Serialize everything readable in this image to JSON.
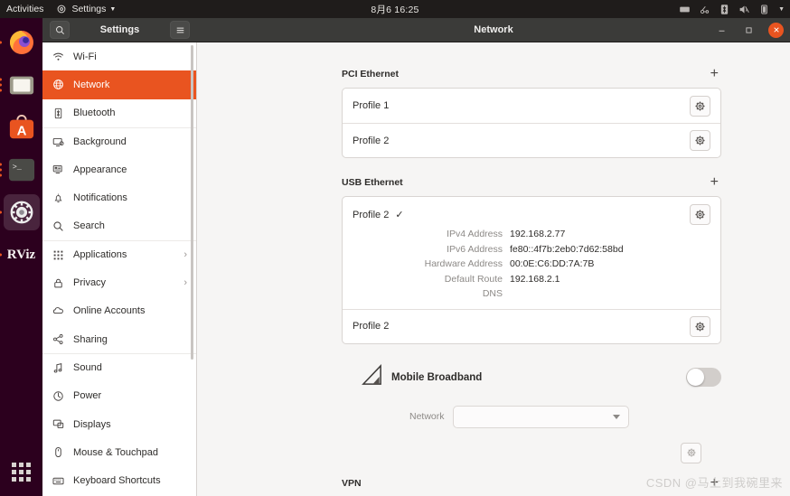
{
  "topbar": {
    "activities": "Activities",
    "app_menu": "Settings",
    "clock": "8月6  16:25",
    "indicators": [
      "keyboard-icon",
      "network-icon",
      "bluetooth-icon",
      "volume-icon",
      "battery-icon",
      "chevron-down-icon"
    ]
  },
  "dock": {
    "items": [
      {
        "name": "firefox",
        "label": "Firefox"
      },
      {
        "name": "files",
        "label": "Files"
      },
      {
        "name": "ubuntu-software",
        "label": "Ubuntu Software"
      },
      {
        "name": "terminal",
        "label": "Terminal"
      },
      {
        "name": "settings",
        "label": "Settings"
      },
      {
        "name": "rviz",
        "label": "RViz"
      }
    ],
    "show_apps": "Show Applications"
  },
  "window": {
    "sidebar_title": "Settings",
    "main_title": "Network",
    "search_icon": "search-icon",
    "menu_icon": "hamburger-icon",
    "minimize": "–",
    "maximize": "❐",
    "close": "✕"
  },
  "sidebar": {
    "items": [
      {
        "label": "Wi-Fi",
        "icon": "wifi-icon",
        "selected": false,
        "chevron": false,
        "sep": false
      },
      {
        "label": "Network",
        "icon": "network-globe-icon",
        "selected": true,
        "chevron": false,
        "sep": false
      },
      {
        "label": "Bluetooth",
        "icon": "bluetooth-icon",
        "selected": false,
        "chevron": false,
        "sep": false
      },
      {
        "label": "Background",
        "icon": "background-icon",
        "selected": false,
        "chevron": false,
        "sep": true
      },
      {
        "label": "Appearance",
        "icon": "appearance-icon",
        "selected": false,
        "chevron": false,
        "sep": false
      },
      {
        "label": "Notifications",
        "icon": "bell-icon",
        "selected": false,
        "chevron": false,
        "sep": false
      },
      {
        "label": "Search",
        "icon": "search-icon",
        "selected": false,
        "chevron": false,
        "sep": false
      },
      {
        "label": "Applications",
        "icon": "apps-grid-icon",
        "selected": false,
        "chevron": true,
        "sep": true
      },
      {
        "label": "Privacy",
        "icon": "lock-icon",
        "selected": false,
        "chevron": true,
        "sep": false
      },
      {
        "label": "Online Accounts",
        "icon": "cloud-icon",
        "selected": false,
        "chevron": false,
        "sep": false
      },
      {
        "label": "Sharing",
        "icon": "share-icon",
        "selected": false,
        "chevron": false,
        "sep": false
      },
      {
        "label": "Sound",
        "icon": "sound-note-icon",
        "selected": false,
        "chevron": false,
        "sep": true
      },
      {
        "label": "Power",
        "icon": "power-icon",
        "selected": false,
        "chevron": false,
        "sep": false
      },
      {
        "label": "Displays",
        "icon": "displays-icon",
        "selected": false,
        "chevron": false,
        "sep": false
      },
      {
        "label": "Mouse & Touchpad",
        "icon": "mouse-icon",
        "selected": false,
        "chevron": false,
        "sep": false
      },
      {
        "label": "Keyboard Shortcuts",
        "icon": "keyboard-icon",
        "selected": false,
        "chevron": false,
        "sep": false
      }
    ]
  },
  "content": {
    "pci_ethernet": {
      "title": "PCI Ethernet",
      "add_label": "+",
      "rows": [
        {
          "name": "Profile 1",
          "connected": false
        },
        {
          "name": "Profile 2",
          "connected": false
        }
      ]
    },
    "usb_ethernet": {
      "title": "USB Ethernet",
      "add_label": "+",
      "active_profile": {
        "name": "Profile 2",
        "connected": true,
        "check": "✓",
        "details": [
          {
            "key": "IPv4 Address",
            "value": "192.168.2.77"
          },
          {
            "key": "IPv6 Address",
            "value": "fe80::4f7b:2eb0:7d62:58bd"
          },
          {
            "key": "Hardware Address",
            "value": "00:0E:C6:DD:7A:7B"
          },
          {
            "key": "Default Route",
            "value": "192.168.2.1"
          },
          {
            "key": "DNS",
            "value": ""
          }
        ]
      },
      "rows": [
        {
          "name": "Profile 2",
          "connected": false
        }
      ]
    },
    "mobile_broadband": {
      "title": "Mobile Broadband",
      "icon": "cellular-signal-icon",
      "toggle_on": false,
      "network_label": "Network",
      "network_value": "",
      "settings_icon": "gear-icon"
    },
    "vpn": {
      "title": "VPN",
      "add_label": "+"
    }
  },
  "watermark": "CSDN @马上到我碗里来",
  "colors": {
    "accent": "#e95420",
    "panel_bg": "#f6f5f4",
    "card_bg": "#ffffff",
    "titlebar": "#3b3b39",
    "topbar": "#1f1c1b",
    "dock": "#2c001e"
  }
}
